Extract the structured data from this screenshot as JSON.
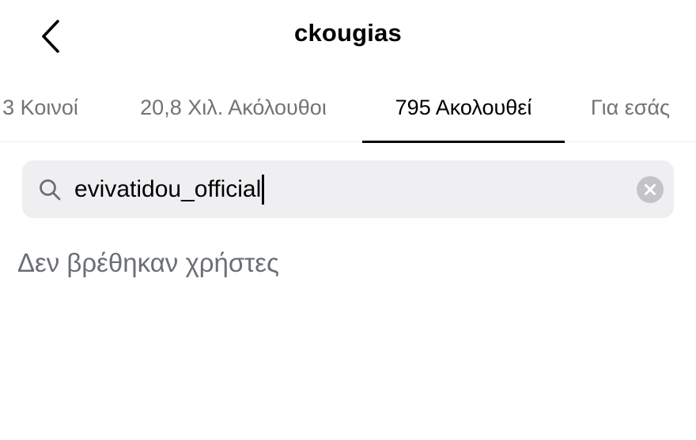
{
  "header": {
    "title": "ckougias",
    "back_icon": "chevron-left-icon"
  },
  "tabs": [
    {
      "label": "3 Κοινοί",
      "active": false
    },
    {
      "label": "20,8 Χιλ. Ακόλουθοι",
      "active": false
    },
    {
      "label": "795 Ακολουθεί",
      "active": true
    },
    {
      "label": "Για εσάς",
      "active": false
    }
  ],
  "search": {
    "value": "evivatidou_official",
    "icon": "search-icon",
    "clear_icon": "clear-circle-icon"
  },
  "results": {
    "empty_message": "Δεν βρέθηκαν χρήστες"
  },
  "colors": {
    "background": "#ffffff",
    "search_background": "#efeff1",
    "muted_text": "#737373",
    "active_tab_underline": "#000000"
  }
}
